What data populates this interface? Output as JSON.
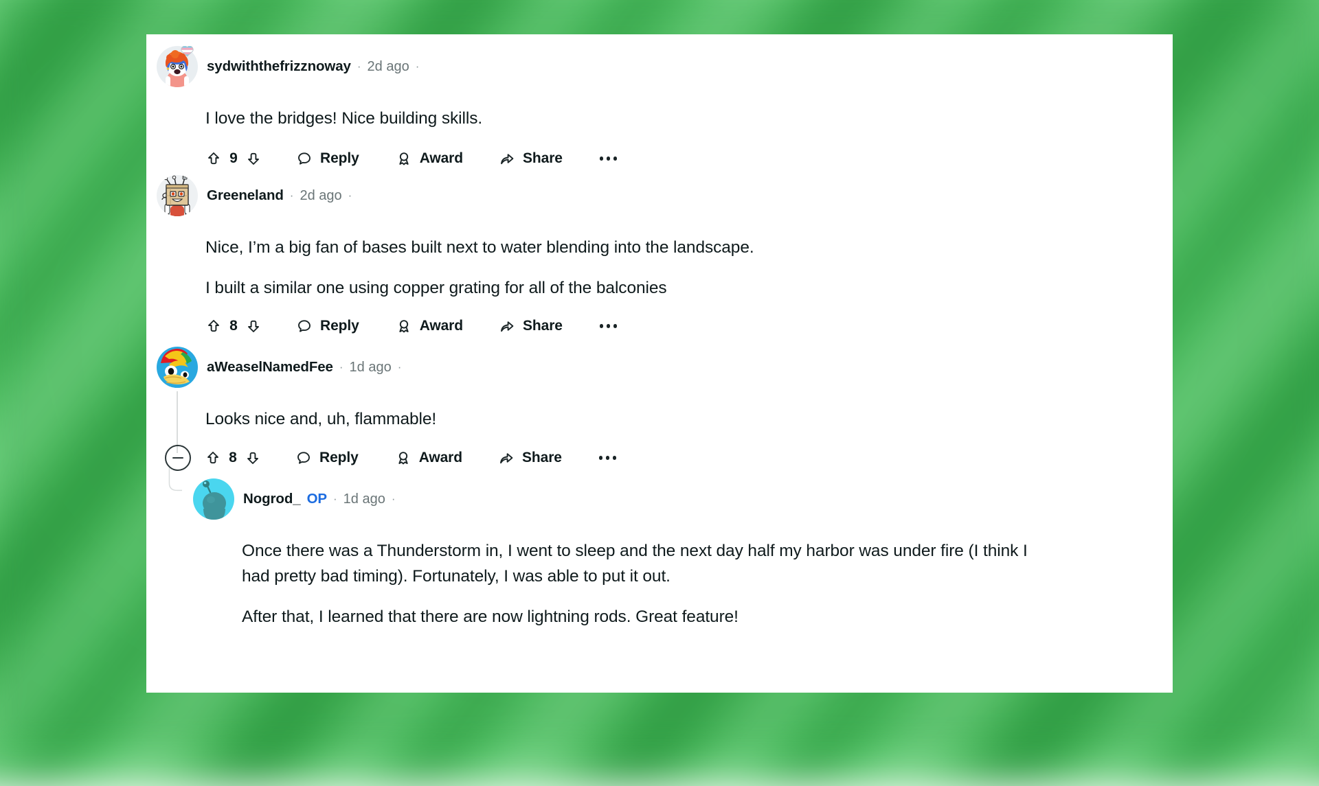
{
  "background": {
    "description": "blurred green diagonal gradient",
    "colors": [
      "#3fae52",
      "#54c468",
      "#74d184",
      "#339f47",
      "#2f9c43"
    ]
  },
  "card": {
    "background_color": "#ffffff"
  },
  "labels": {
    "reply": "Reply",
    "award": "Award",
    "share": "Share",
    "more": "more-options",
    "op": "OP",
    "separator": "·"
  },
  "colors": {
    "op_badge": "#1c6ce0",
    "username": "#0f1a1c",
    "timestamp": "#6a7577",
    "body_text": "#0f1a1c",
    "thread_line": "#d9dddd"
  },
  "comments": [
    {
      "id": "c1",
      "username": "sydwiththefrizznoway",
      "timestamp": "2d ago",
      "is_op": false,
      "avatar": "snoo-orange-hair-trans-heart",
      "paragraphs": [
        "I love the bridges! Nice building skills."
      ],
      "votes": "9",
      "collapsible": false,
      "depth": 0
    },
    {
      "id": "c2",
      "username": "Greeneland",
      "timestamp": "2d ago",
      "is_op": false,
      "avatar": "snoo-cardboard-box-head",
      "paragraphs": [
        "Nice, I’m a big fan of bases built next to water blending into the landscape.",
        "I built a similar one using copper grating for all of the balconies"
      ],
      "votes": "8",
      "collapsible": false,
      "depth": 0
    },
    {
      "id": "c3",
      "username": "aWeaselNamedFee",
      "timestamp": "1d ago",
      "is_op": false,
      "avatar": "snoo-blue-yellow-red-bird",
      "paragraphs": [
        "Looks nice and, uh, flammable!"
      ],
      "votes": "8",
      "collapsible": true,
      "depth": 0
    },
    {
      "id": "c4",
      "username": "Nogrod_",
      "timestamp": "1d ago",
      "is_op": true,
      "avatar": "snoo-cyan-teal",
      "paragraphs": [
        "Once there was a Thunderstorm in, I went to sleep and the next day half my harbor was under fire (I think I had pretty bad timing). Fortunately, I was able to put it out.",
        "After that, I learned that there are now lightning rods. Great feature!"
      ],
      "votes": "",
      "collapsible": false,
      "depth": 1
    }
  ],
  "icons": {
    "upvote": "upvote-arrow-icon",
    "downvote": "downvote-arrow-icon",
    "reply": "comment-bubble-icon",
    "award": "award-ribbon-icon",
    "share": "share-arrow-icon",
    "more": "ellipsis-icon",
    "collapse": "collapse-minus-icon"
  }
}
